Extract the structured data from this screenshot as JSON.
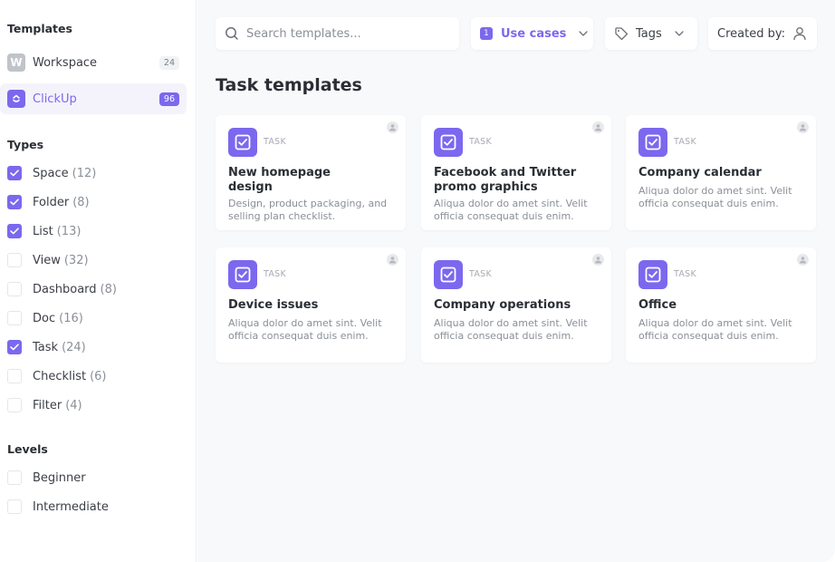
{
  "sidebar": {
    "templates_title": "Templates",
    "sources": [
      {
        "label": "Workspace",
        "count": "24",
        "icon": "W",
        "active": false
      },
      {
        "label": "ClickUp",
        "count": "96",
        "icon": "clickup-logo",
        "active": true
      }
    ],
    "types_title": "Types",
    "types": [
      {
        "label": "Space",
        "count": "(12)",
        "checked": true
      },
      {
        "label": "Folder",
        "count": "(8)",
        "checked": true
      },
      {
        "label": "List",
        "count": "(13)",
        "checked": true
      },
      {
        "label": "View",
        "count": "(32)",
        "checked": false
      },
      {
        "label": "Dashboard",
        "count": "(8)",
        "checked": false
      },
      {
        "label": "Doc",
        "count": "(16)",
        "checked": false
      },
      {
        "label": "Task",
        "count": "(24)",
        "checked": true
      },
      {
        "label": "Checklist",
        "count": "(6)",
        "checked": false
      },
      {
        "label": "Filter",
        "count": "(4)",
        "checked": false
      }
    ],
    "levels_title": "Levels",
    "levels": [
      {
        "label": "Beginner",
        "checked": false
      },
      {
        "label": "Intermediate",
        "checked": false
      }
    ]
  },
  "toolbar": {
    "search_placeholder": "Search templates...",
    "use_cases_count": "1",
    "use_cases_label": "Use cases",
    "tags_label": "Tags",
    "created_by_label": "Created by:"
  },
  "main": {
    "title": "Task templates",
    "cards": [
      {
        "type": "TASK",
        "title": "New homepage design",
        "title_lines": [
          "New homepage",
          "design"
        ],
        "description": "Design, product packaging, and selling plan checklist."
      },
      {
        "type": "TASK",
        "title": "Facebook and Twitter promo graphics",
        "title_lines": [
          "Facebook and Twitter",
          "promo graphics"
        ],
        "description": "Aliqua dolor do amet sint. Velit officia consequat duis enim."
      },
      {
        "type": "TASK",
        "title": "Company calendar",
        "title_lines": [
          "Company calendar"
        ],
        "description": "Aliqua dolor do amet sint. Velit officia consequat duis enim."
      },
      {
        "type": "TASK",
        "title": "Device issues",
        "title_lines": [
          "Device issues"
        ],
        "description": "Aliqua dolor do amet sint. Velit officia consequat duis enim."
      },
      {
        "type": "TASK",
        "title": "Company operations",
        "title_lines": [
          "Company operations"
        ],
        "description": "Aliqua dolor do amet sint. Velit officia consequat duis enim."
      },
      {
        "type": "TASK",
        "title": "Office",
        "title_lines": [
          "Office"
        ],
        "description": "Aliqua dolor do amet sint. Velit officia consequat duis enim."
      }
    ]
  },
  "colors": {
    "accent": "#7b68ee",
    "workspace_icon": "#c0c3c9",
    "main_bg": "#f8f9fb"
  }
}
